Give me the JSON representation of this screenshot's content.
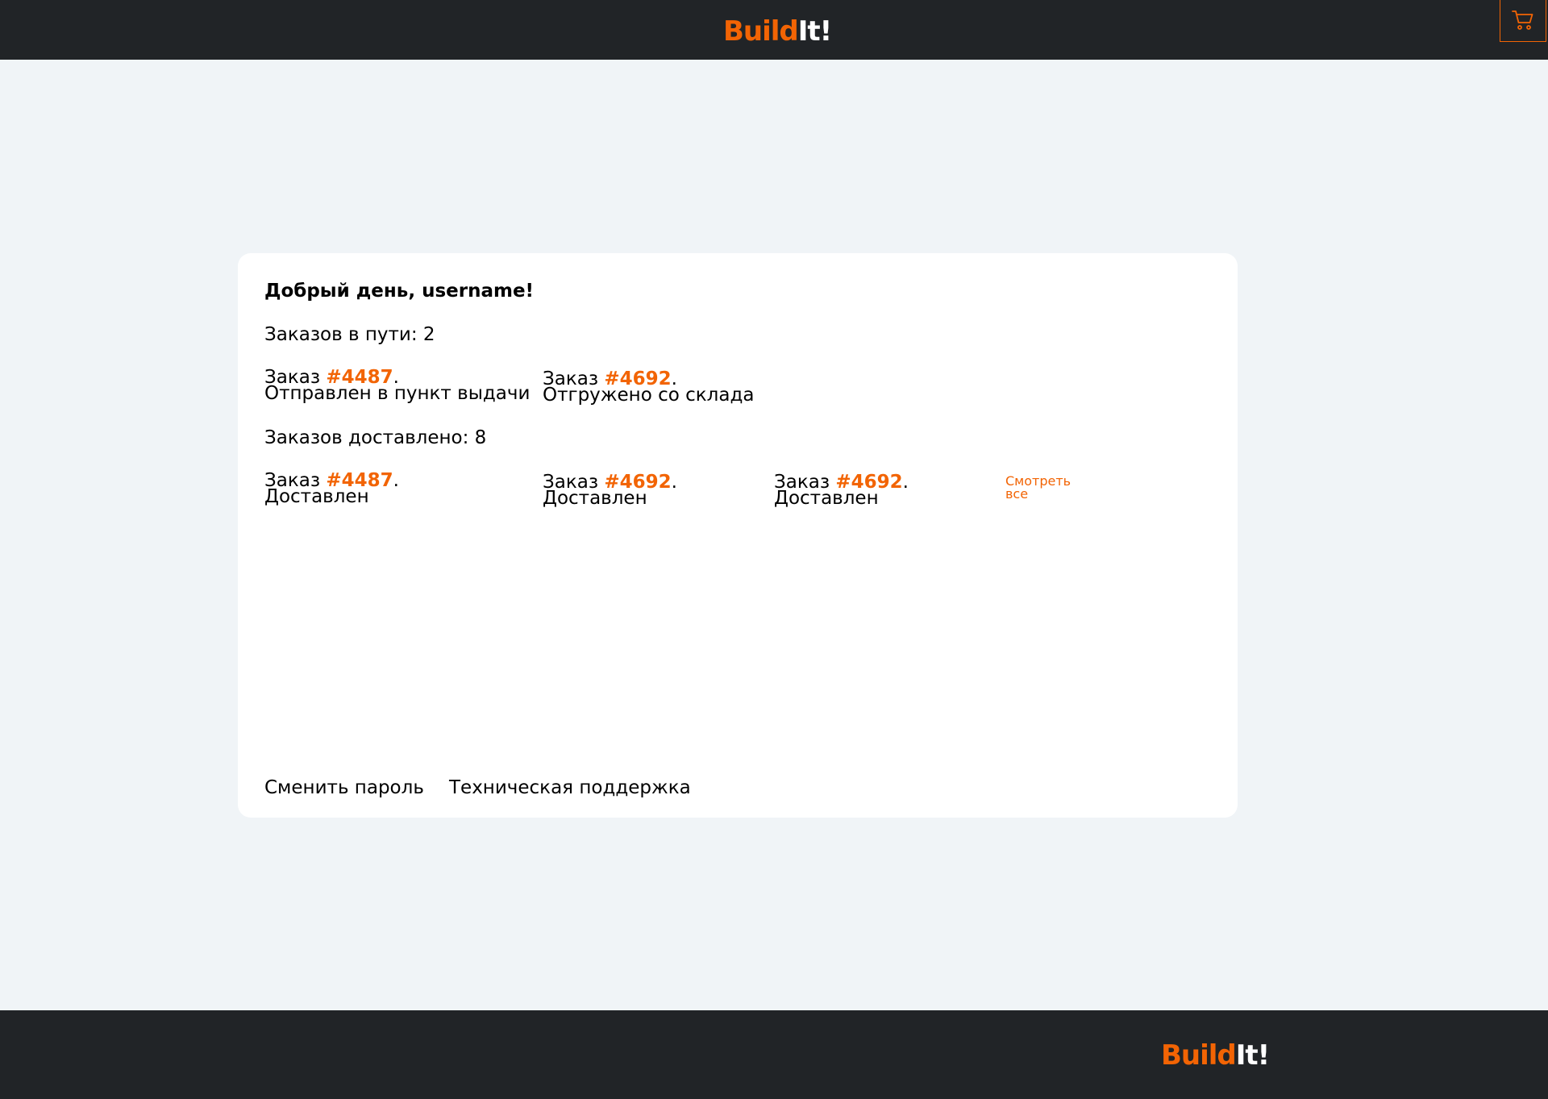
{
  "brand": {
    "part1": "Build",
    "part2": "It!",
    "accent_color": "#f26404",
    "dark_color": "#212427"
  },
  "header": {
    "cart_icon": "cart-icon"
  },
  "account": {
    "greeting": "Добрый день, username!",
    "in_transit": {
      "title": "Заказов в пути: 2",
      "orders": [
        {
          "prefix": "Заказ ",
          "number": "#4487",
          "suffix": ".",
          "status": "Отправлен в пункт выдачи"
        },
        {
          "prefix": "Заказ ",
          "number": "#4692",
          "suffix": ".",
          "status": "Отгружено со склада"
        }
      ]
    },
    "delivered": {
      "title": "Заказов доставлено: 8",
      "orders": [
        {
          "prefix": "Заказ ",
          "number": "#4487",
          "suffix": ".",
          "status": "Доставлен"
        },
        {
          "prefix": "Заказ ",
          "number": "#4692",
          "suffix": ".",
          "status": "Доставлен"
        },
        {
          "prefix": "Заказ ",
          "number": "#4692",
          "suffix": ".",
          "status": "Доставлен"
        }
      ],
      "see_all": "Смотреть все"
    },
    "links": {
      "change_password": "Сменить пароль",
      "support": "Техническая поддержка"
    }
  }
}
